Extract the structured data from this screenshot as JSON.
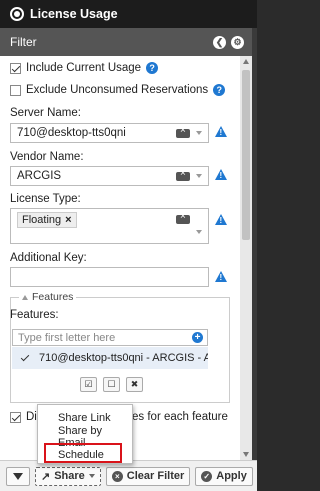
{
  "title": "License Usage",
  "filter": {
    "label": "Filter"
  },
  "include_current_usage": {
    "label": "Include Current Usage",
    "checked": true
  },
  "exclude_unconsumed": {
    "label": "Exclude Unconsumed Reservations",
    "checked": false
  },
  "server_name": {
    "label": "Server Name:",
    "value": "710@desktop-tts0qni"
  },
  "vendor_name": {
    "label": "Vendor Name:",
    "value": "ARCGIS"
  },
  "license_type": {
    "label": "License Type:",
    "tag": "Floating"
  },
  "additional_key": {
    "label": "Additional Key:",
    "value": ""
  },
  "features": {
    "legend": "Features",
    "label": "Features:",
    "placeholder": "Type first letter here",
    "items": [
      "710@desktop-tts0qni - ARCGIS - AC"
    ]
  },
  "display_option": {
    "text_left": "Dis",
    "text_right": "nes for each feature",
    "checked": true
  },
  "menu": {
    "items": [
      "Share Link",
      "Share by Email",
      "Schedule"
    ],
    "highlight": "Schedule"
  },
  "bottom": {
    "share": "Share",
    "clear_filter": "Clear Filter",
    "apply": "Apply"
  },
  "colors": {
    "accent": "#1f78d1",
    "highlight": "#d9131a"
  }
}
